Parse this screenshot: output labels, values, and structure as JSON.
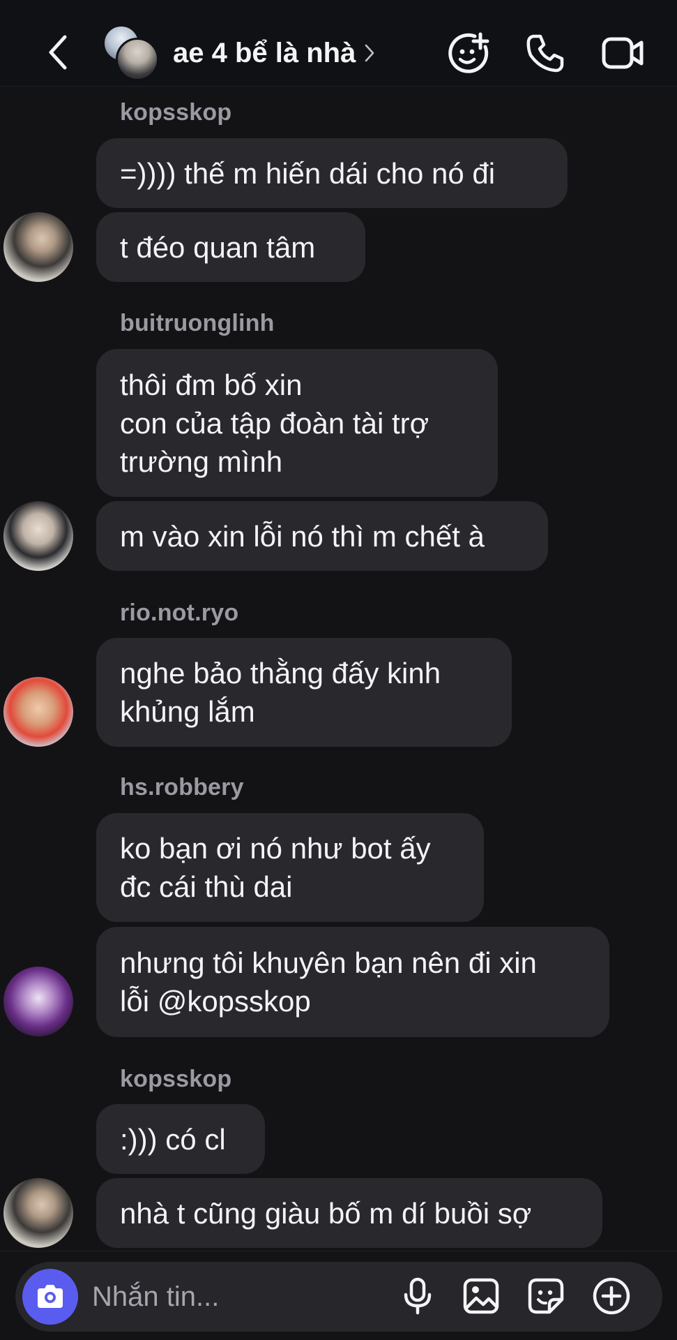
{
  "header": {
    "title": "ae 4 bể là nhà",
    "icons": {
      "back": "chevron-left-icon",
      "title_chevron": "chevron-right-icon",
      "effects": "sticker-plus-icon",
      "call": "phone-icon",
      "video": "video-icon"
    }
  },
  "messages": [
    {
      "sender": "kopsskop",
      "bubbles": [
        "=)))) thế m hiến dái cho nó đi",
        "t đéo quan tâm"
      ]
    },
    {
      "sender": "buitruonglinh",
      "bubbles": [
        "thôi đm bố xin\ncon của tập đoàn tài trợ\ntrường mình",
        "m vào xin lỗi nó thì m chết à"
      ]
    },
    {
      "sender": "rio.not.ryo",
      "bubbles": [
        "nghe bảo thằng đấy kinh\nkhủng lắm"
      ]
    },
    {
      "sender": "hs.robbery",
      "bubbles": [
        "ko bạn ơi nó như bot ấy\nđc cái thù dai",
        "nhưng tôi khuyên bạn nên đi xin\nlỗi @kopsskop"
      ]
    },
    {
      "sender": "kopsskop",
      "bubbles": [
        ":))) có cl",
        "nhà t cũng giàu bố m dí buồi sợ"
      ]
    }
  ],
  "composer": {
    "placeholder": "Nhắn tin...",
    "icons": [
      "camera-icon",
      "microphone-icon",
      "image-icon",
      "sticker-icon",
      "plus-circle-icon"
    ]
  },
  "colors": {
    "background": "#131316",
    "bubble": "#28282d",
    "camera_button": "#5a5cf0",
    "sender_text": "#9a9aa3"
  }
}
